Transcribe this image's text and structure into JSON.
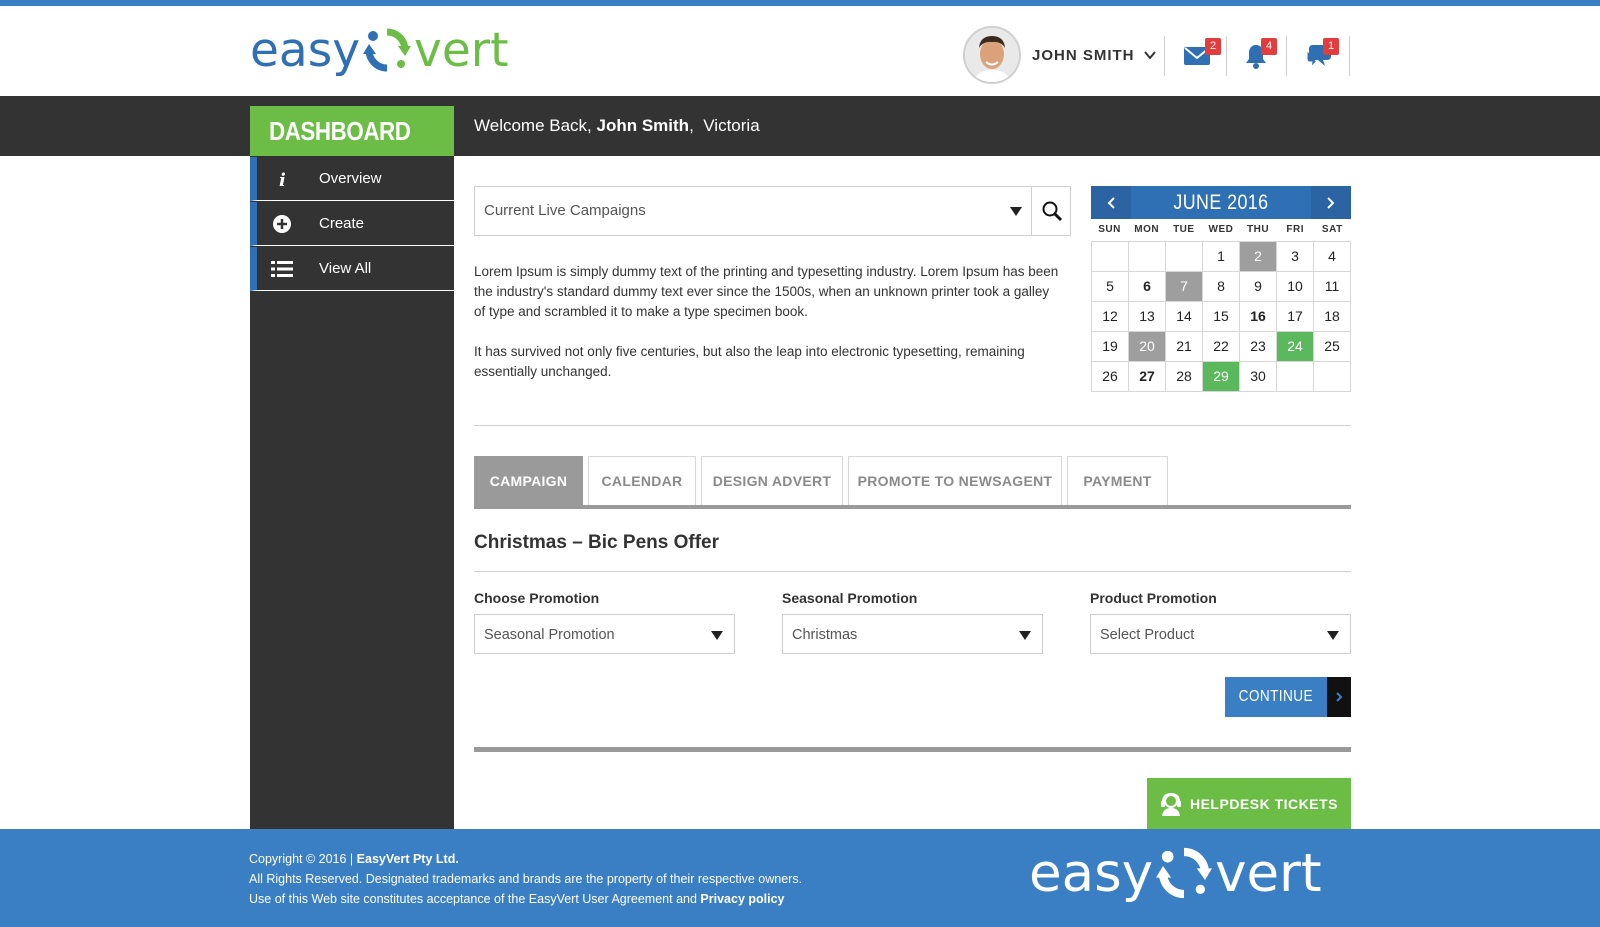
{
  "brand": {
    "logo_part1": "easy",
    "logo_part2": "vert",
    "accent_blue": "#3a7fc4",
    "accent_green": "#6cbd45"
  },
  "header": {
    "user_name": "JOHN SMITH",
    "messages_badge": "2",
    "notifications_badge": "4",
    "chat_badge": "1"
  },
  "dashboard": {
    "label": "DASHBOARD",
    "welcome_prefix": "Welcome Back,",
    "welcome_name": "John Smith",
    "welcome_location": "Victoria"
  },
  "sidebar": {
    "items": [
      {
        "label": "Overview",
        "icon": "info-icon"
      },
      {
        "label": "Create",
        "icon": "plus-circle-icon"
      },
      {
        "label": "View All",
        "icon": "list-icon"
      }
    ]
  },
  "campaigns": {
    "selected": "Current Live Campaigns",
    "paragraph1": "Lorem Ipsum is simply dummy text of the printing and typesetting industry. Lorem Ipsum has been the industry's standard dummy text ever since the 1500s, when an unknown printer took a galley of type and scrambled it to make a type specimen book.",
    "paragraph2": "It has survived not only five centuries, but also the leap into electronic typesetting, remaining essentially unchanged."
  },
  "calendar": {
    "title": "JUNE 2016",
    "weekdays": [
      "SUN",
      "MON",
      "TUE",
      "WED",
      "THU",
      "FRI",
      "SAT"
    ],
    "cells": [
      {
        "d": "",
        "s": ""
      },
      {
        "d": "",
        "s": ""
      },
      {
        "d": "",
        "s": ""
      },
      {
        "d": "1",
        "s": ""
      },
      {
        "d": "2",
        "s": "gray"
      },
      {
        "d": "3",
        "s": ""
      },
      {
        "d": "4",
        "s": ""
      },
      {
        "d": "5",
        "s": ""
      },
      {
        "d": "6",
        "s": "bold"
      },
      {
        "d": "7",
        "s": "gray"
      },
      {
        "d": "8",
        "s": ""
      },
      {
        "d": "9",
        "s": ""
      },
      {
        "d": "10",
        "s": ""
      },
      {
        "d": "11",
        "s": ""
      },
      {
        "d": "12",
        "s": ""
      },
      {
        "d": "13",
        "s": ""
      },
      {
        "d": "14",
        "s": ""
      },
      {
        "d": "15",
        "s": ""
      },
      {
        "d": "16",
        "s": "bold"
      },
      {
        "d": "17",
        "s": ""
      },
      {
        "d": "18",
        "s": ""
      },
      {
        "d": "19",
        "s": ""
      },
      {
        "d": "20",
        "s": "gray"
      },
      {
        "d": "21",
        "s": ""
      },
      {
        "d": "22",
        "s": ""
      },
      {
        "d": "23",
        "s": ""
      },
      {
        "d": "24",
        "s": "green"
      },
      {
        "d": "25",
        "s": ""
      },
      {
        "d": "26",
        "s": ""
      },
      {
        "d": "27",
        "s": "bold"
      },
      {
        "d": "28",
        "s": ""
      },
      {
        "d": "29",
        "s": "green"
      },
      {
        "d": "30",
        "s": ""
      },
      {
        "d": "",
        "s": ""
      },
      {
        "d": "",
        "s": ""
      }
    ]
  },
  "tabs": [
    {
      "label": "CAMPAIGN",
      "active": true
    },
    {
      "label": "CALENDAR",
      "active": false
    },
    {
      "label": "DESIGN ADVERT",
      "active": false
    },
    {
      "label": "PROMOTE TO NEWSAGENT",
      "active": false
    },
    {
      "label": "PAYMENT",
      "active": false
    }
  ],
  "form": {
    "title": "Christmas – Bic Pens Offer",
    "choose_label": "Choose Promotion",
    "choose_value": "Seasonal Promotion",
    "seasonal_label": "Seasonal Promotion",
    "seasonal_value": "Christmas",
    "product_label": "Product Promotion",
    "product_value": "Select Product",
    "continue_label": "CONTINUE"
  },
  "helpdesk": {
    "label": "HELPDESK TICKETS"
  },
  "footer": {
    "copyright": "Copyright © 2016 |",
    "company": "EasyVert Pty Ltd.",
    "rights": "All Rights Reserved. Designated trademarks and brands are the property of their respective owners.",
    "agreement": "Use of this Web site constitutes acceptance of the EasyVert User Agreement and",
    "privacy": "Privacy policy"
  }
}
